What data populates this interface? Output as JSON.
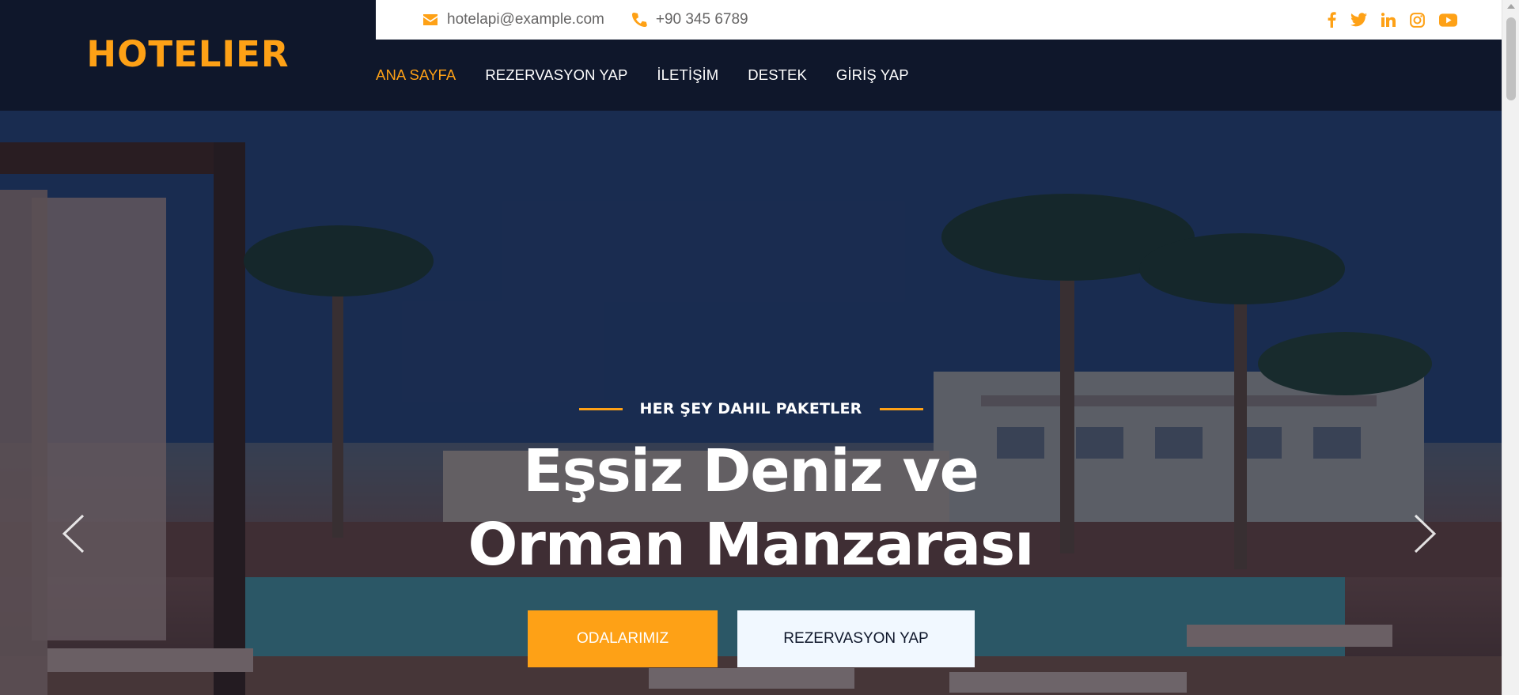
{
  "brand": {
    "name": "HOTELIER"
  },
  "topbar": {
    "email": "hotelapi@example.com",
    "phone": "+90 345 6789",
    "socials": [
      "facebook-icon",
      "twitter-icon",
      "linkedin-icon",
      "instagram-icon",
      "youtube-icon"
    ]
  },
  "nav": {
    "items": [
      {
        "label": "ANA SAYFA",
        "active": true
      },
      {
        "label": "REZERVASYON YAP",
        "active": false
      },
      {
        "label": "İLETİŞİM",
        "active": false
      },
      {
        "label": "DESTEK",
        "active": false
      },
      {
        "label": "GİRİŞ YAP",
        "active": false
      }
    ]
  },
  "hero": {
    "subtitle": "HER ŞEY DAHIL PAKETLER",
    "title_line1": "Eşsiz Deniz ve",
    "title_line2": "Orman Manzarası",
    "primary_button": "ODALARIMIZ",
    "secondary_button": "REZERVASYON YAP",
    "prev_icon": "chevron-left-icon",
    "next_icon": "chevron-right-icon"
  },
  "colors": {
    "accent": "#fea116",
    "dark": "#0f172b",
    "light_button": "#f1f8ff"
  }
}
